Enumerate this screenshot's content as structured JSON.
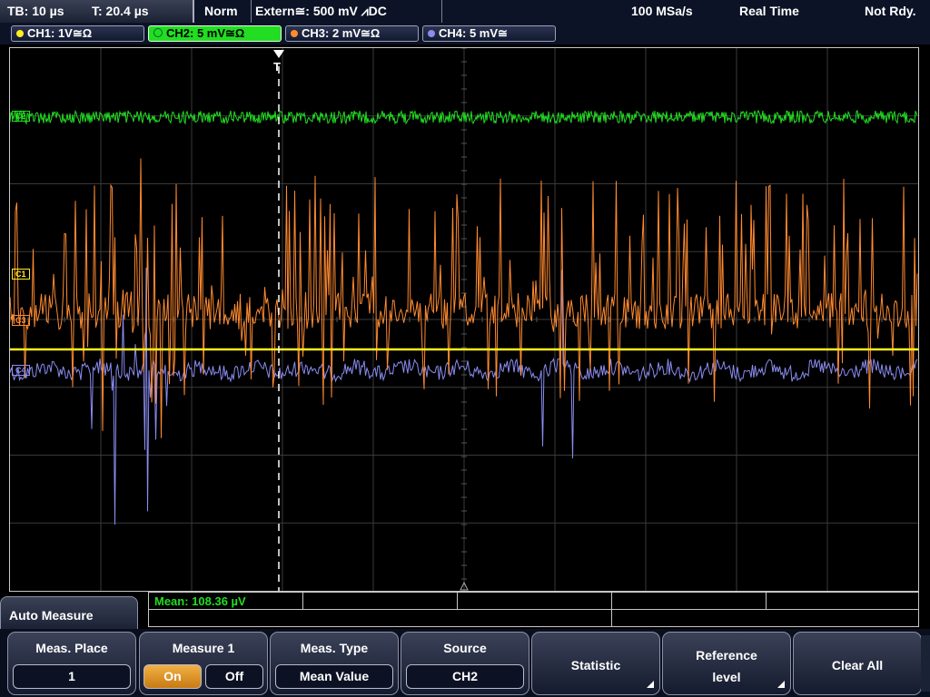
{
  "status": {
    "timebase": "TB: 10 µs",
    "trigger_time": "T: 20.4 µs",
    "mode": "Norm",
    "trigger_source": "Extern≅: 500 mV ⩘DC",
    "sample_rate": "100 MSa/s",
    "acq_mode": "Real Time",
    "state": "Not Rdy."
  },
  "channels": [
    {
      "label": "CH1: 1V≅Ω",
      "color": "#ffee22",
      "active": false
    },
    {
      "label": "CH2: 5 mV≅Ω",
      "color": "#22dd22",
      "active": true
    },
    {
      "label": "CH3: 2 mV≅Ω",
      "color": "#ff8a30",
      "active": false
    },
    {
      "label": "CH4: 5 mV≅",
      "color": "#8a8cf0",
      "active": false
    }
  ],
  "markers": {
    "c1": "C1",
    "c2": "C2",
    "c3": "C3",
    "c4": "C4",
    "trigger": "T"
  },
  "measurement": {
    "result": "Mean: 108.36 µV"
  },
  "menu": {
    "title": "Auto Measure",
    "meas_place": {
      "title": "Meas. Place",
      "value": "1"
    },
    "measure": {
      "title": "Measure 1",
      "on": "On",
      "off": "Off",
      "state": "On"
    },
    "meas_type": {
      "title": "Meas. Type",
      "value": "Mean Value"
    },
    "source": {
      "title": "Source",
      "value": "CH2"
    },
    "statistic": "Statistic",
    "reference_level": {
      "line1": "Reference",
      "line2": "level"
    },
    "clear_all": "Clear All"
  },
  "colors": {
    "grid": "#3a3a3a",
    "ch1": "#ffee22",
    "ch2": "#22dd22",
    "ch3": "#ff8a30",
    "ch4": "#8a8cf0"
  }
}
